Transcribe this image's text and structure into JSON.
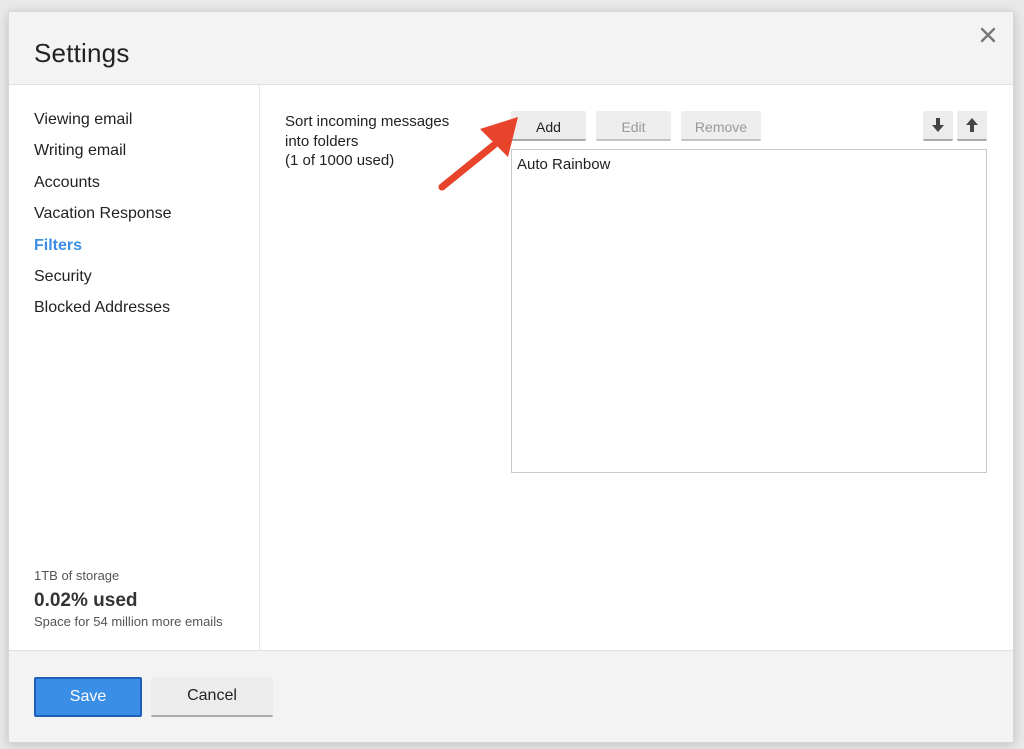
{
  "dialog": {
    "title": "Settings",
    "close_icon": "close-icon"
  },
  "sidebar": {
    "items": [
      {
        "label": "Viewing email"
      },
      {
        "label": "Writing email"
      },
      {
        "label": "Accounts"
      },
      {
        "label": "Vacation Response"
      },
      {
        "label": "Filters",
        "active": true
      },
      {
        "label": "Security"
      },
      {
        "label": "Blocked Addresses"
      }
    ],
    "storage": {
      "total": "1TB of storage",
      "used": "0.02% used",
      "space": "Space for 54 million more emails"
    }
  },
  "filters": {
    "description_line1": "Sort incoming messages",
    "description_line2": "into folders",
    "description_line3": "(1 of 1000 used)",
    "add_label": "Add",
    "edit_label": "Edit",
    "remove_label": "Remove",
    "move_down_icon": "arrow-down-icon",
    "move_up_icon": "arrow-up-icon",
    "list": [
      "Auto Rainbow"
    ]
  },
  "footer": {
    "save_label": "Save",
    "cancel_label": "Cancel"
  },
  "colors": {
    "accent": "#3c8ee5",
    "save_button": "#3a8ee6",
    "annotation_arrow": "#e8432b"
  }
}
